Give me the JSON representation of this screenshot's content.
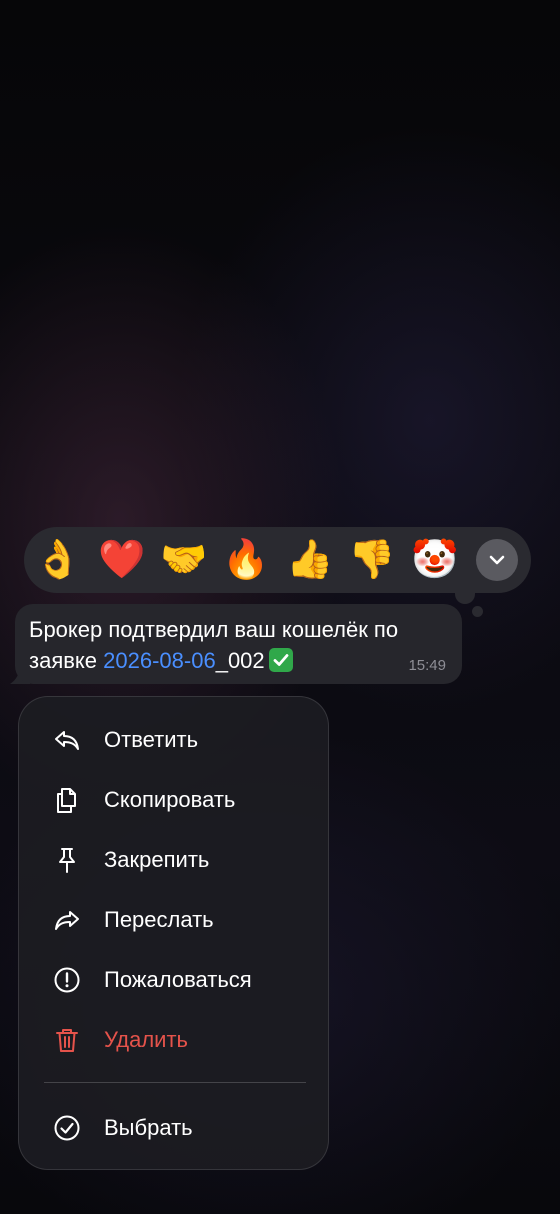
{
  "reactions": {
    "items": [
      "👌",
      "❤️",
      "🤝",
      "🔥",
      "👍",
      "👎",
      "🤡"
    ],
    "expand_icon": "chevron-down-icon"
  },
  "message": {
    "text_before": "Брокер подтвердил ваш кошелёк по заявке ",
    "link_text": "2026-08-06",
    "text_after": "_002",
    "emoji": "check-mark-button-icon",
    "time": "15:49",
    "colors": {
      "bubble": "#26262c",
      "link": "#4a8fff",
      "time": "#8e8e96"
    }
  },
  "menu": {
    "items": [
      {
        "label": "Ответить",
        "icon": "reply-icon"
      },
      {
        "label": "Скопировать",
        "icon": "copy-icon"
      },
      {
        "label": "Закрепить",
        "icon": "pin-icon"
      },
      {
        "label": "Переслать",
        "icon": "forward-icon"
      },
      {
        "label": "Пожаловаться",
        "icon": "report-icon"
      },
      {
        "label": "Удалить",
        "icon": "trash-icon",
        "danger": true
      }
    ],
    "select": {
      "label": "Выбрать",
      "icon": "select-check-icon"
    },
    "colors": {
      "danger": "#e5534b",
      "text": "#ffffff"
    }
  }
}
